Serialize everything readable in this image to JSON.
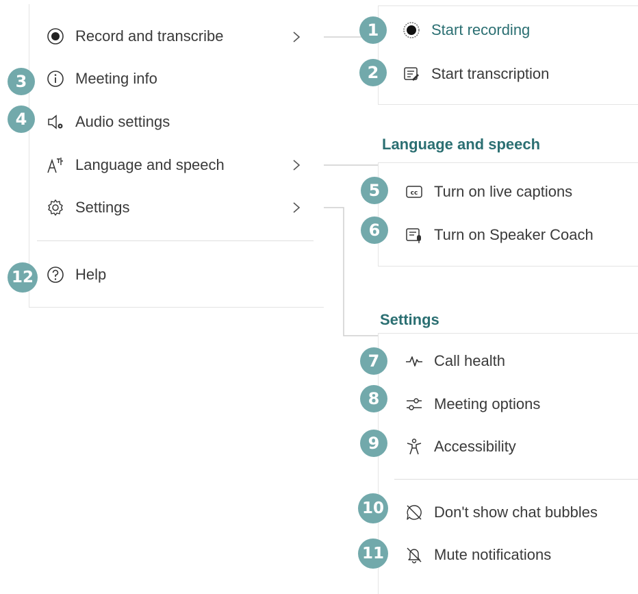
{
  "main_menu": {
    "items": [
      {
        "label": "Record and transcribe",
        "icon": "record-icon",
        "has_submenu": true
      },
      {
        "label": "Meeting info",
        "icon": "info-icon",
        "has_submenu": false
      },
      {
        "label": "Audio settings",
        "icon": "speaker-gear-icon",
        "has_submenu": false
      },
      {
        "label": "Language and speech",
        "icon": "language-icon",
        "has_submenu": true
      },
      {
        "label": "Settings",
        "icon": "gear-icon",
        "has_submenu": true
      },
      {
        "label": "Help",
        "icon": "help-icon",
        "has_submenu": false
      }
    ]
  },
  "record_submenu": {
    "items": [
      {
        "label": "Start recording",
        "icon": "record-icon"
      },
      {
        "label": "Start transcription",
        "icon": "transcription-icon"
      }
    ]
  },
  "language_submenu": {
    "title": "Language and speech",
    "items": [
      {
        "label": "Turn on live captions",
        "icon": "cc-icon"
      },
      {
        "label": "Turn on Speaker Coach",
        "icon": "speaker-coach-icon"
      }
    ]
  },
  "settings_submenu": {
    "title": "Settings",
    "items": [
      {
        "label": "Call health",
        "icon": "pulse-icon"
      },
      {
        "label": "Meeting options",
        "icon": "sliders-icon"
      },
      {
        "label": "Accessibility",
        "icon": "accessibility-icon"
      },
      {
        "label": "Don't show chat bubbles",
        "icon": "chat-off-icon"
      },
      {
        "label": "Mute notifications",
        "icon": "bell-off-icon"
      }
    ]
  },
  "badges": [
    "1",
    "2",
    "3",
    "4",
    "5",
    "6",
    "7",
    "8",
    "9",
    "10",
    "11",
    "12"
  ],
  "colors": {
    "badge": "#72a9ab",
    "accent": "#2b6f72",
    "text": "#3a3a3a",
    "border": "#e4e4e4"
  }
}
